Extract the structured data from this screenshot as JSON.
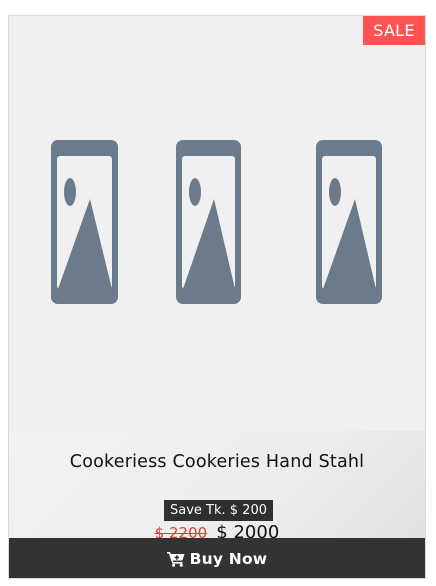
{
  "product": {
    "sale_badge": "SALE",
    "title": "Cookeriess Cookeries Hand Stahl",
    "save_text": "Save Tk. $ 200",
    "old_price": "$ 2200",
    "new_price": "$ 2000",
    "buy_label": "Buy Now",
    "images": [
      "image-placeholder-icon",
      "image-placeholder-icon",
      "image-placeholder-icon"
    ]
  },
  "colors": {
    "sale": "#ff5252",
    "old_price": "#e53935",
    "button": "#333333",
    "placeholder_icon": "#6b7b8c"
  }
}
